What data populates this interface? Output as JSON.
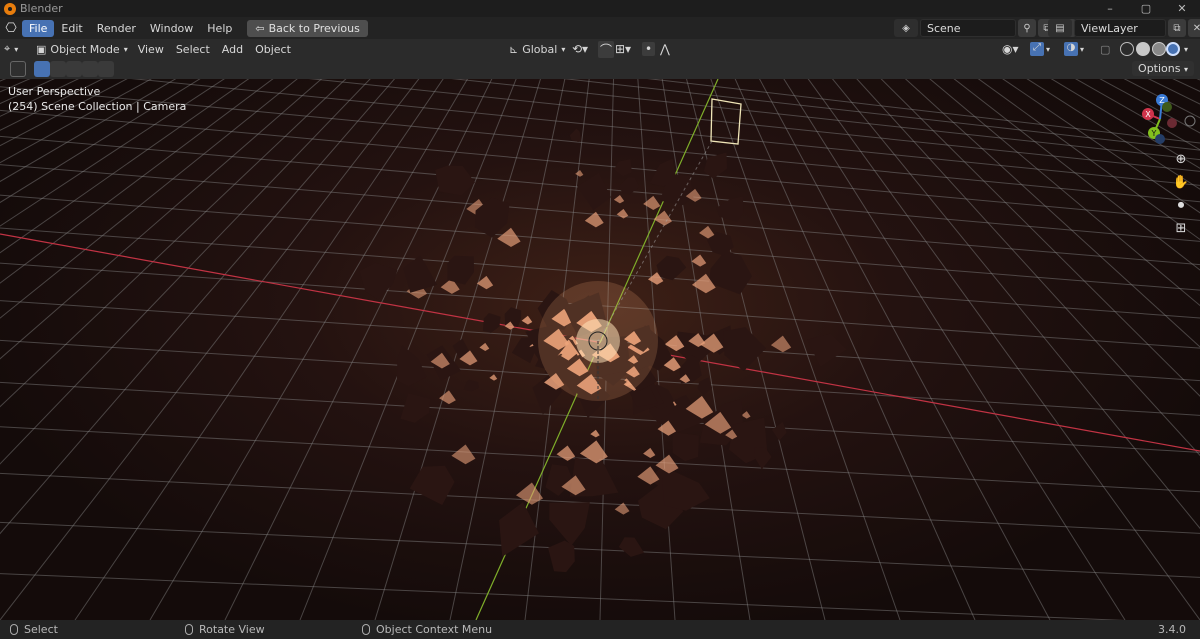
{
  "window": {
    "title": "Blender",
    "min": "–",
    "max": "▢",
    "close": "✕"
  },
  "menu": {
    "items": [
      "File",
      "Edit",
      "Render",
      "Window",
      "Help"
    ],
    "back_button": "Back to Previous"
  },
  "scene": {
    "label": "Scene",
    "viewlayer": "ViewLayer"
  },
  "header": {
    "mode": "Object Mode",
    "items": [
      "View",
      "Select",
      "Add",
      "Object"
    ],
    "orientation": "Global"
  },
  "toolbar": {
    "options": "Options"
  },
  "viewport": {
    "perspective": "User Perspective",
    "collection": "(254) Scene Collection | Camera"
  },
  "gizmo": {
    "x": "X",
    "y": "Y",
    "z": "Z"
  },
  "status": {
    "select": "Select",
    "rotate": "Rotate View",
    "context": "Object Context Menu",
    "version": "3.4.0"
  },
  "colors": {
    "accent": "#4772b3",
    "x_axis": "#d0334b",
    "y_axis": "#82c01e",
    "z_axis": "#3a7bd6",
    "debris": "#e8a07a"
  }
}
